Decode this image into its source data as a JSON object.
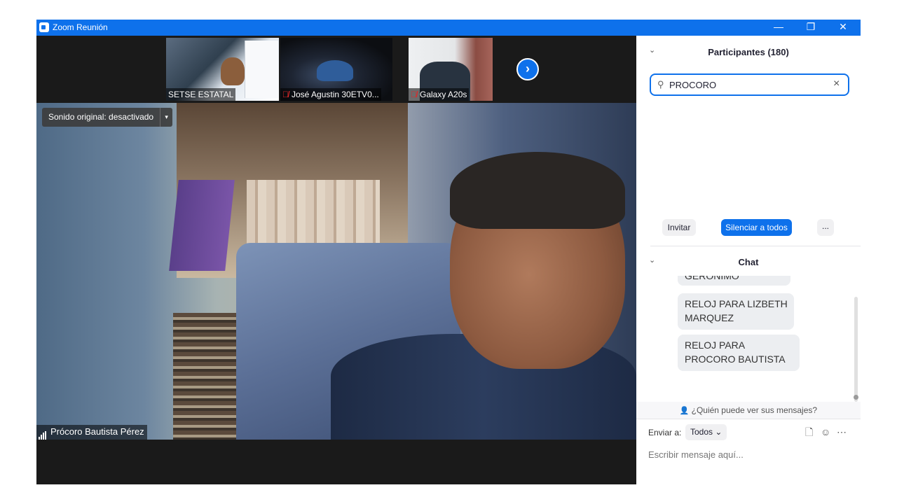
{
  "window": {
    "title": "Zoom Reunión",
    "controls": {
      "minimize": "—",
      "restore": "❐",
      "close": "✕"
    }
  },
  "thumbnails": [
    {
      "name": "SETSE ESTATAL",
      "muted": false
    },
    {
      "name": "José Agustin 30ETV0...",
      "muted": true
    },
    {
      "name": "Galaxy A20s",
      "muted": true
    }
  ],
  "strip_next": "›",
  "main_video": {
    "sound_label": "Sonido original: desactivado",
    "sound_caret": "▾",
    "speaker_name": "Prócoro Bautista Pérez"
  },
  "participants": {
    "chevron": "⌄",
    "title": "Participantes (180)",
    "search_value": "PROCORO",
    "search_icon": "search-icon",
    "invite": "Invitar",
    "mute_all": "Silenciar a todos",
    "more": "..."
  },
  "chat": {
    "chevron": "⌄",
    "title": "Chat",
    "messages": [
      {
        "text": "GERONIMO"
      },
      {
        "text": "RELOJ PARA  LIZBETH MARQUEZ"
      },
      {
        "text": "RELOJ PARA PROCORO BAUTISTA"
      }
    ],
    "who_sees": "¿Quién puede ver sus mensajes?",
    "send_to_label": "Enviar a:",
    "send_to_value": "Todos",
    "placeholder": "Escribir mensaje aquí..."
  },
  "colors": {
    "accent": "#0e71eb",
    "video_bg": "#1a1a1a"
  }
}
